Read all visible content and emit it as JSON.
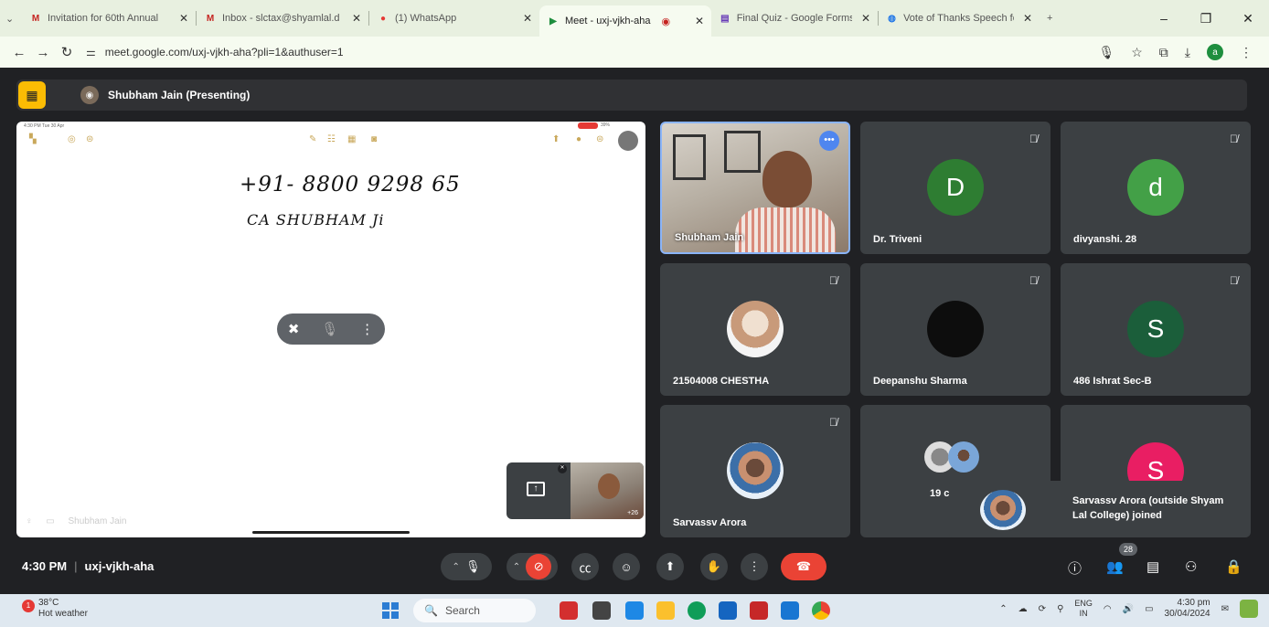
{
  "browser": {
    "tabs": [
      {
        "label": "Invitation for 60th Annual",
        "icon": "gmail-icon",
        "color": "#c5221f"
      },
      {
        "label": "Inbox - slctax@shyamlal.d",
        "icon": "gmail-icon",
        "color": "#c5221f"
      },
      {
        "label": "(1) WhatsApp",
        "icon": "whatsapp-icon",
        "color": "#e53935"
      },
      {
        "label": "Meet - uxj-vjkh-aha",
        "icon": "meet-icon",
        "color": "#1e8e3e"
      },
      {
        "label": "Final Quiz - Google Forms",
        "icon": "forms-icon",
        "color": "#673ab7"
      },
      {
        "label": "Vote of Thanks Speech for",
        "icon": "chrome-icon",
        "color": "#1a73e8"
      }
    ],
    "url": "meet.google.com/uxj-vjkh-aha?pli=1&authuser=1",
    "profile_initial": "a"
  },
  "meet": {
    "presenter_banner": "Shubham Jain (Presenting)",
    "stage": {
      "status_time": "4:30 PM  Tue 30 Apr",
      "battery": "39%",
      "line1": "+91- 8800 9298 65",
      "line2": "CA SHUBHAM Ji",
      "footer_name": "Shubham Jain",
      "self_count": "+26"
    },
    "participants": [
      {
        "name": "Shubham Jain",
        "type": "video",
        "speaking": true
      },
      {
        "name": "Dr. Triveni",
        "initial": "D",
        "color": "#2e7d32"
      },
      {
        "name": "divyanshi. 28",
        "initial": "d",
        "color": "#43a047"
      },
      {
        "name": "21504008 CHESTHA",
        "type": "photo"
      },
      {
        "name": "Deepanshu Sharma",
        "type": "photo-dark"
      },
      {
        "name": "486 Ishrat Sec-B",
        "initial": "S",
        "color": "#1b5e3a"
      },
      {
        "name": "Sarvassv Arora",
        "type": "photo"
      },
      {
        "name": "19 c",
        "type": "group"
      },
      {
        "name": "",
        "initial": "S",
        "color": "#e91e63"
      }
    ],
    "toast": "Sarvassv Arora (outside Shyam Lal College) joined",
    "time": "4:30 PM",
    "meeting_code": "uxj-vjkh-aha",
    "participant_count": "28"
  },
  "taskbar": {
    "temp": "38°C",
    "weather": "Hot weather",
    "search": "Search",
    "lang1": "ENG",
    "lang2": "IN",
    "time": "4:30 pm",
    "date": "30/04/2024"
  }
}
